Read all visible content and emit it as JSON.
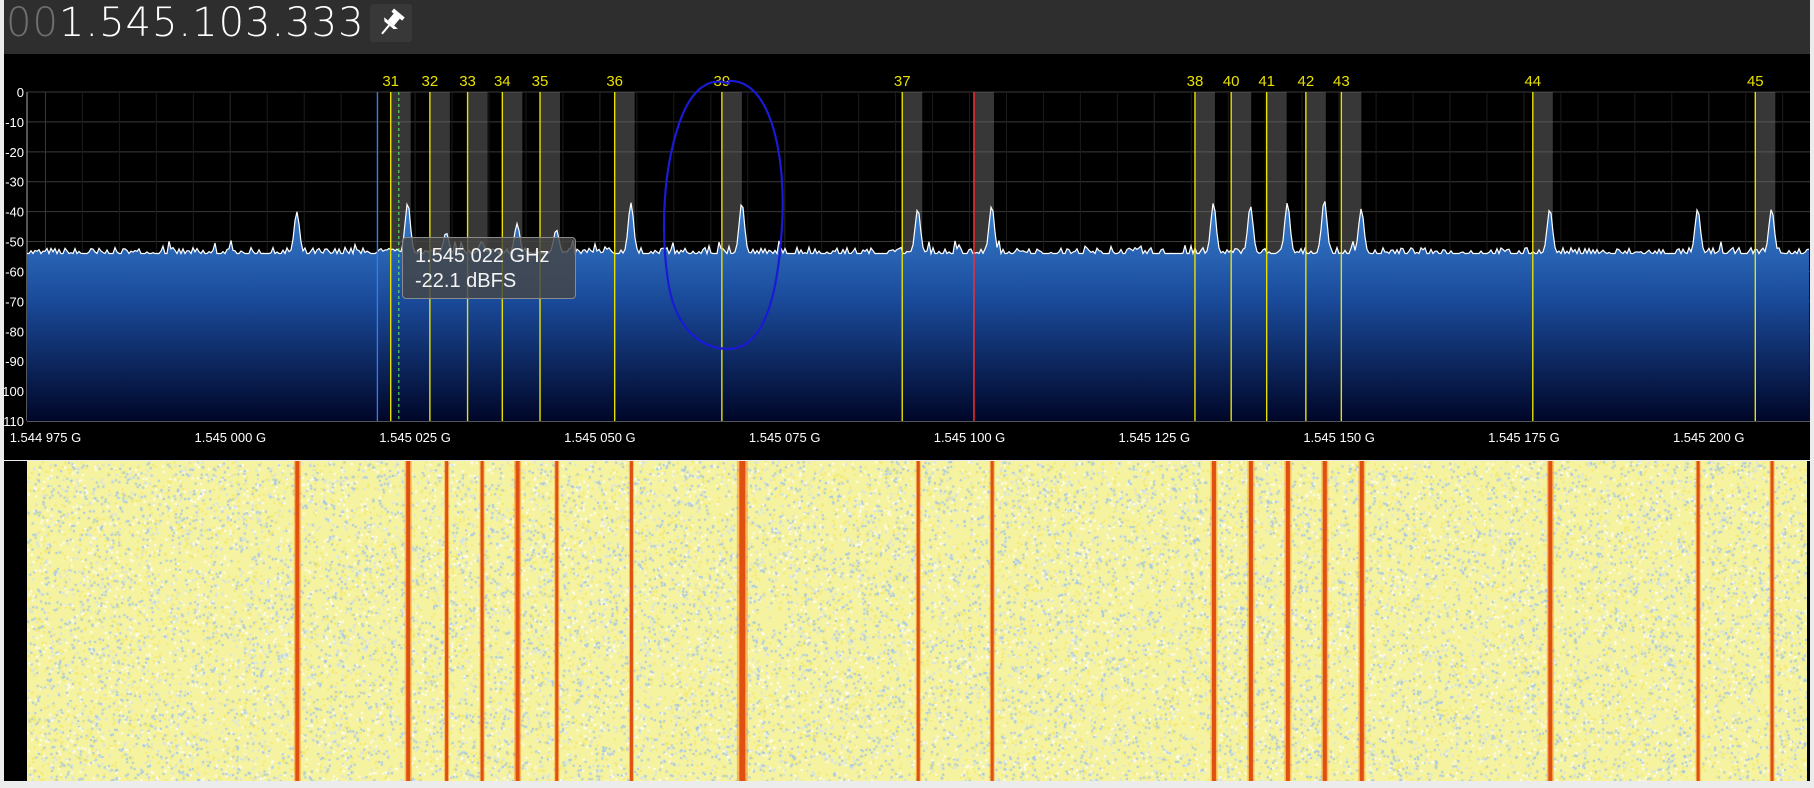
{
  "frequency": {
    "leading": "00",
    "value": "1.545.103.333"
  },
  "icons": {
    "pin": "pin-icon"
  },
  "colors": {
    "marker": "#e8e000",
    "highlight_band": "#7a7a7a",
    "tuned_line": "#ff2a2a",
    "cursor_line": "#2a7fff",
    "spectrum_fill_top": "#3d82d0",
    "spectrum_fill_bottom": "#000a2a",
    "trace": "#ffffff",
    "annotation": "#1a1ad6",
    "waterfall_bg": "#f6f3a0",
    "waterfall_line": "#e05010"
  },
  "spectrum": {
    "y_ticks": [
      "0",
      "-10",
      "-20",
      "-30",
      "-40",
      "-50",
      "-60",
      "-70",
      "-80",
      "-90",
      "-100",
      "-110"
    ],
    "x_ticks": [
      {
        "label": "1.544 975 G",
        "f": 1544.975
      },
      {
        "label": "1.545 000 G",
        "f": 1545.0
      },
      {
        "label": "1.545 025 G",
        "f": 1545.025
      },
      {
        "label": "1.545 050 G",
        "f": 1545.05
      },
      {
        "label": "1.545 075 G",
        "f": 1545.075
      },
      {
        "label": "1.545 100 G",
        "f": 1545.1
      },
      {
        "label": "1.545 125 G",
        "f": 1545.125
      },
      {
        "label": "1.545 150 G",
        "f": 1545.15
      },
      {
        "label": "1.545 175 G",
        "f": 1545.175
      },
      {
        "label": "1.545 200 G",
        "f": 1545.2
      }
    ],
    "f_min": 1544.9725,
    "f_max": 1545.2137,
    "noise_floor_db": -54,
    "markers": [
      {
        "label": "31",
        "f": 1545.0217
      },
      {
        "label": "32",
        "f": 1545.027
      },
      {
        "label": "33",
        "f": 1545.0321
      },
      {
        "label": "34",
        "f": 1545.0368
      },
      {
        "label": "35",
        "f": 1545.0419
      },
      {
        "label": "36",
        "f": 1545.052
      },
      {
        "label": "39",
        "f": 1545.0665
      },
      {
        "label": "37",
        "f": 1545.0909
      },
      {
        "label": "38",
        "f": 1545.1305
      },
      {
        "label": "40",
        "f": 1545.1354
      },
      {
        "label": "41",
        "f": 1545.1402
      },
      {
        "label": "42",
        "f": 1545.1455
      },
      {
        "label": "43",
        "f": 1545.1503
      },
      {
        "label": "44",
        "f": 1545.1762
      },
      {
        "label": "45",
        "f": 1545.2063
      }
    ],
    "cursor_f": 1545.0199,
    "cursor_dashed_f": 1545.0228,
    "tuned_f": 1545.1006,
    "peaks": [
      {
        "f": 1545.009,
        "db": -40
      },
      {
        "f": 1545.024,
        "db": -37
      },
      {
        "f": 1545.0292,
        "db": -47
      },
      {
        "f": 1545.034,
        "db": -50
      },
      {
        "f": 1545.0388,
        "db": -44
      },
      {
        "f": 1545.0441,
        "db": -46
      },
      {
        "f": 1545.0542,
        "db": -37
      },
      {
        "f": 1545.0692,
        "db": -37
      },
      {
        "f": 1545.093,
        "db": -39
      },
      {
        "f": 1545.103,
        "db": -38
      },
      {
        "f": 1545.133,
        "db": -37
      },
      {
        "f": 1545.138,
        "db": -38
      },
      {
        "f": 1545.143,
        "db": -37
      },
      {
        "f": 1545.148,
        "db": -36
      },
      {
        "f": 1545.153,
        "db": -39
      },
      {
        "f": 1545.1785,
        "db": -39
      },
      {
        "f": 1545.1985,
        "db": -39
      },
      {
        "f": 1545.2085,
        "db": -39
      }
    ],
    "tooltip": {
      "frequency": "1.545 022 GHz",
      "level": "-22.1 dBFS"
    }
  },
  "waterfall": {
    "lines": [
      {
        "f": 1545.009,
        "w": 3
      },
      {
        "f": 1545.024,
        "w": 3
      },
      {
        "f": 1545.0292,
        "w": 2
      },
      {
        "f": 1545.034,
        "w": 2
      },
      {
        "f": 1545.0388,
        "w": 3
      },
      {
        "f": 1545.0441,
        "w": 2
      },
      {
        "f": 1545.0542,
        "w": 2
      },
      {
        "f": 1545.0692,
        "w": 5
      },
      {
        "f": 1545.093,
        "w": 2
      },
      {
        "f": 1545.103,
        "w": 2
      },
      {
        "f": 1545.133,
        "w": 3
      },
      {
        "f": 1545.138,
        "w": 3
      },
      {
        "f": 1545.143,
        "w": 3
      },
      {
        "f": 1545.148,
        "w": 3
      },
      {
        "f": 1545.153,
        "w": 3
      },
      {
        "f": 1545.1785,
        "w": 3
      },
      {
        "f": 1545.1985,
        "w": 2
      },
      {
        "f": 1545.2085,
        "w": 2
      }
    ]
  }
}
